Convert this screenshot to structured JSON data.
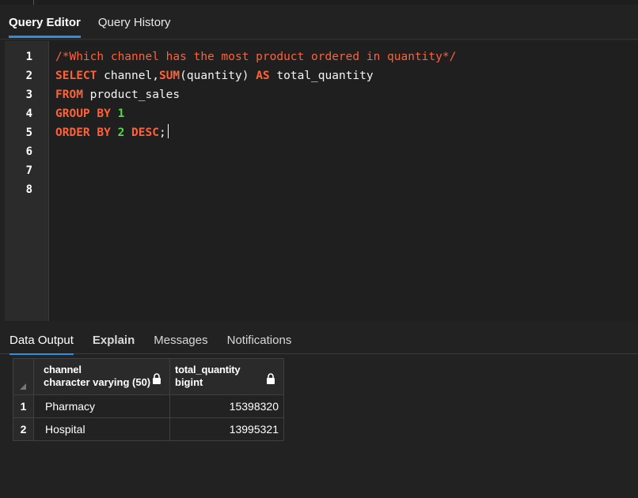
{
  "editor_tabs": [
    {
      "label": "Query Editor",
      "active": true
    },
    {
      "label": "Query History",
      "active": false
    }
  ],
  "editor": {
    "line_numbers": [
      "1",
      "2",
      "3",
      "4",
      "5",
      "6",
      "7",
      "8"
    ],
    "lines": [
      [
        {
          "t": "/*Which channel has the most product ordered in quantity*/",
          "c": "cm"
        }
      ],
      [
        {
          "t": "SELECT",
          "c": "kw"
        },
        {
          "t": " channel,",
          "c": ""
        },
        {
          "t": "SUM",
          "c": "fn"
        },
        {
          "t": "(quantity) ",
          "c": ""
        },
        {
          "t": "AS",
          "c": "kw"
        },
        {
          "t": " total_quantity",
          "c": ""
        }
      ],
      [
        {
          "t": "FROM",
          "c": "kw"
        },
        {
          "t": " product_sales",
          "c": ""
        }
      ],
      [
        {
          "t": "GROUP BY",
          "c": "kw"
        },
        {
          "t": " ",
          "c": ""
        },
        {
          "t": "1",
          "c": "num"
        }
      ],
      [
        {
          "t": "ORDER BY",
          "c": "kw"
        },
        {
          "t": " ",
          "c": ""
        },
        {
          "t": "2",
          "c": "num"
        },
        {
          "t": " ",
          "c": ""
        },
        {
          "t": "DESC",
          "c": "kw"
        },
        {
          "t": ";",
          "c": ""
        }
      ],
      [],
      [],
      []
    ],
    "cursor_line": 4
  },
  "output_tabs": [
    {
      "label": "Data Output",
      "active": true
    },
    {
      "label": "Explain",
      "active": false
    },
    {
      "label": "Messages",
      "active": false
    },
    {
      "label": "Notifications",
      "active": false
    }
  ],
  "result": {
    "columns": [
      {
        "name": "channel",
        "type": "character varying (50)",
        "icon": "lock-icon"
      },
      {
        "name": "total_quantity",
        "type": "bigint",
        "icon": "lock-icon"
      }
    ],
    "rows": [
      {
        "num": "1",
        "channel": "Pharmacy",
        "total_quantity": "15398320"
      },
      {
        "num": "2",
        "channel": "Hospital",
        "total_quantity": "13995321"
      }
    ]
  },
  "colors": {
    "keyword": "#ff6138",
    "number": "#59d64c",
    "accent": "#2d8fe0",
    "background": "#222222"
  }
}
